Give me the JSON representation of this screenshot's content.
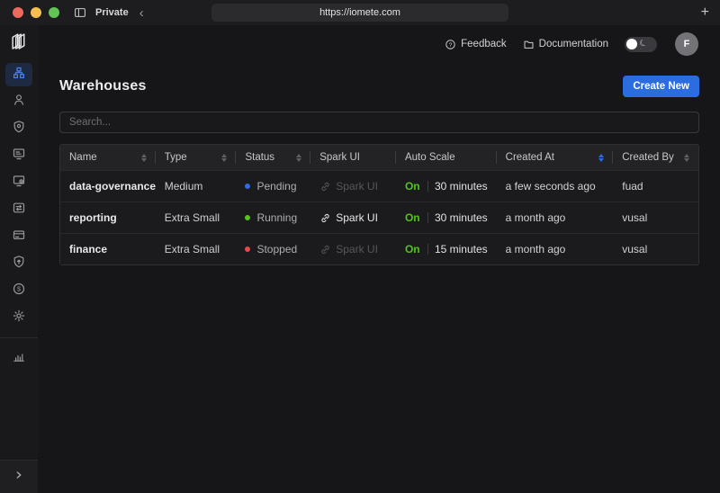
{
  "browser": {
    "private_label": "Private",
    "url": "https://iomete.com"
  },
  "topbar": {
    "feedback_label": "Feedback",
    "documentation_label": "Documentation",
    "avatar_initial": "F"
  },
  "icons": {
    "plus": "+",
    "back_chevron": "‹",
    "question_mark": "?",
    "dollar": "$",
    "moon": "☾"
  },
  "sidebar": {
    "items": [
      {
        "icon": "warehouses-icon",
        "active": true
      },
      {
        "icon": "users-icon",
        "active": false
      },
      {
        "icon": "access-shield-icon",
        "active": false
      },
      {
        "icon": "sql-editor-icon",
        "active": false
      },
      {
        "icon": "spark-jobs-icon",
        "active": false
      },
      {
        "icon": "data-transfer-icon",
        "active": false
      },
      {
        "icon": "billing-card-icon",
        "active": false
      },
      {
        "icon": "deploy-shield-icon",
        "active": false
      },
      {
        "icon": "usage-dollar-icon",
        "active": false
      },
      {
        "icon": "settings-gear-icon",
        "active": false
      }
    ],
    "secondary_items": [
      {
        "icon": "monitoring-chart-icon",
        "active": false
      }
    ],
    "collapse_icon": "chevron-right-icon"
  },
  "page": {
    "title": "Warehouses",
    "create_button_label": "Create New",
    "search_placeholder": "Search..."
  },
  "table": {
    "columns": [
      {
        "label": "Name",
        "sortable": true,
        "sort_active": false
      },
      {
        "label": "Type",
        "sortable": true,
        "sort_active": false
      },
      {
        "label": "Status",
        "sortable": true,
        "sort_active": false
      },
      {
        "label": "Spark UI",
        "sortable": false,
        "sort_active": false
      },
      {
        "label": "Auto Scale",
        "sortable": false,
        "sort_active": false
      },
      {
        "label": "Created At",
        "sortable": true,
        "sort_active": true
      },
      {
        "label": "Created By",
        "sortable": true,
        "sort_active": false
      }
    ],
    "rows": [
      {
        "name": "data-governance",
        "type": "Medium",
        "status": "Pending",
        "status_color": "#2f6be4",
        "spark_ui_label": "Spark UI",
        "spark_ui_enabled": false,
        "auto_scale_state": "On",
        "auto_scale_interval": "30 minutes",
        "created_at": "a few seconds ago",
        "created_by": "fuad"
      },
      {
        "name": "reporting",
        "type": "Extra Small",
        "status": "Running",
        "status_color": "#52c41a",
        "spark_ui_label": "Spark UI",
        "spark_ui_enabled": true,
        "auto_scale_state": "On",
        "auto_scale_interval": "30 minutes",
        "created_at": "a month ago",
        "created_by": "vusal"
      },
      {
        "name": "finance",
        "type": "Extra Small",
        "status": "Stopped",
        "status_color": "#e5484d",
        "spark_ui_label": "Spark UI",
        "spark_ui_enabled": false,
        "auto_scale_state": "On",
        "auto_scale_interval": "15 minutes",
        "created_at": "a month ago",
        "created_by": "vusal"
      }
    ]
  },
  "colors": {
    "accent_blue": "#2b6de0",
    "status_pending": "#2f6be4",
    "status_running": "#52c41a",
    "status_stopped": "#e5484d",
    "auto_scale_on": "#52c41a",
    "sort_active": "#2f6be4",
    "traffic_red": "#ec6a5e",
    "traffic_yellow": "#f4bf4f",
    "traffic_green": "#61c554"
  }
}
